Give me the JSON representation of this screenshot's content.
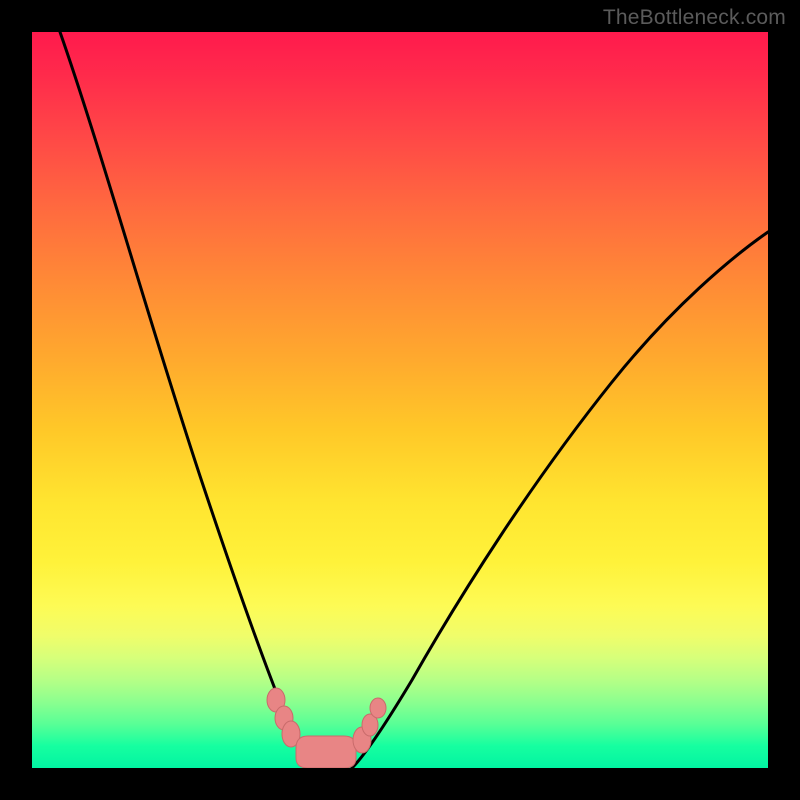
{
  "watermark": "TheBottleneck.com",
  "chart_data": {
    "type": "line",
    "title": "",
    "xlabel": "",
    "ylabel": "",
    "x_range": [
      0,
      100
    ],
    "y_range": [
      0,
      100
    ],
    "background": "rainbow-gradient-vertical",
    "series": [
      {
        "name": "left-curve",
        "x": [
          4,
          10,
          15,
          20,
          24,
          27,
          29,
          30.5,
          32,
          33.5,
          35,
          36,
          37,
          38,
          39
        ],
        "values": [
          100,
          85,
          71,
          57,
          44,
          33,
          24,
          17,
          11,
          7,
          4,
          2.4,
          1.2,
          0.4,
          0
        ]
      },
      {
        "name": "right-curve",
        "x": [
          42,
          43,
          44.5,
          46,
          48,
          52,
          56,
          60,
          66,
          72,
          78,
          85,
          92,
          100
        ],
        "values": [
          0,
          0.6,
          1.8,
          3.8,
          7,
          13,
          19,
          25,
          34,
          42,
          50,
          58,
          66,
          73
        ]
      }
    ],
    "threshold": {
      "description": "shaded-ok-zone",
      "x_start": 32,
      "x_end": 46,
      "markers_x": [
        33,
        35,
        36.5,
        38,
        39.5,
        41,
        42.5,
        44
      ]
    },
    "gradient_stops": [
      {
        "pos": 0.0,
        "color": "#ff1a4d"
      },
      {
        "pos": 0.34,
        "color": "#ff8a36"
      },
      {
        "pos": 0.64,
        "color": "#ffe530"
      },
      {
        "pos": 0.82,
        "color": "#f0fd6a"
      },
      {
        "pos": 1.0,
        "color": "#02f4a2"
      }
    ]
  }
}
